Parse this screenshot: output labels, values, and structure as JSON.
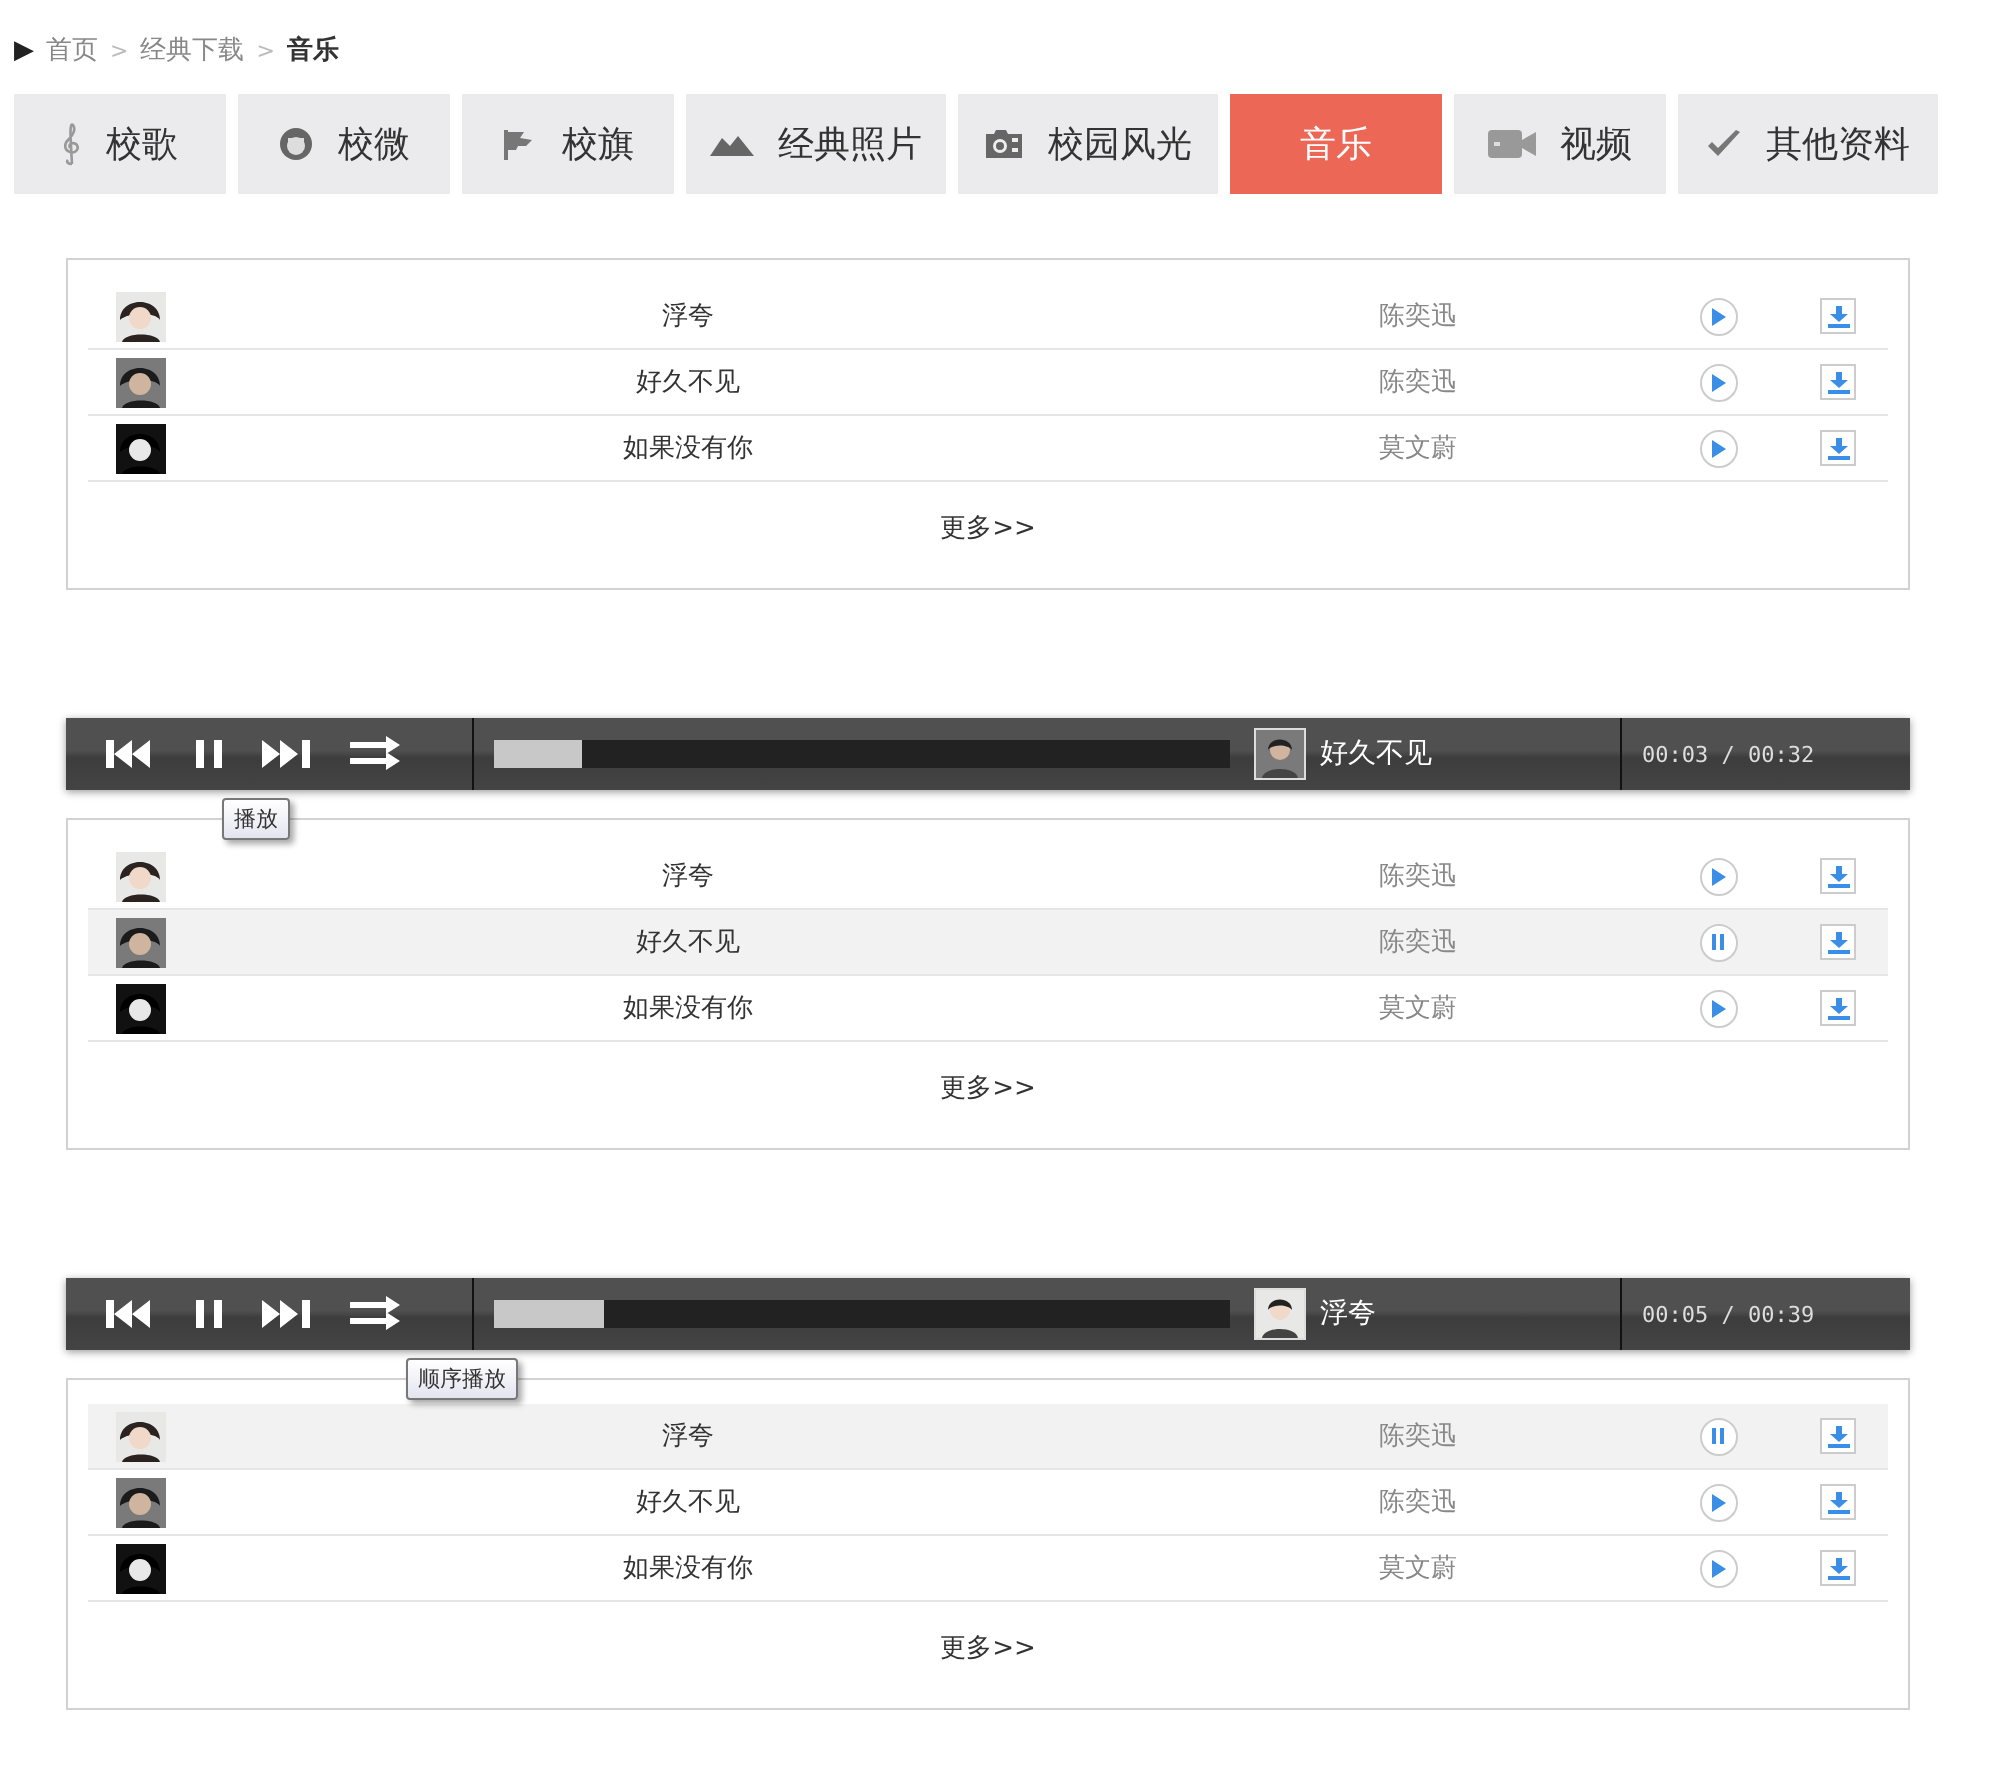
{
  "breadcrumb": {
    "marker": "▶",
    "items": [
      {
        "label": "首页",
        "current": false
      },
      {
        "label": "经典下载",
        "current": false
      },
      {
        "label": "音乐",
        "current": true
      }
    ],
    "separator": ">"
  },
  "tabs": [
    {
      "label": "校歌",
      "selected": false
    },
    {
      "label": "校微",
      "selected": false
    },
    {
      "label": "校旗",
      "selected": false
    },
    {
      "label": "经典照片",
      "selected": false
    },
    {
      "label": "校园风光",
      "selected": false
    },
    {
      "label": "音乐",
      "selected": true
    },
    {
      "label": "视频",
      "selected": false
    },
    {
      "label": "其他资料",
      "selected": false
    }
  ],
  "sections": [
    {
      "more": "更多>>",
      "songs": [
        {
          "title": "浮夸",
          "artist": "陈奕迅",
          "playing": false,
          "selected": false
        },
        {
          "title": "好久不见",
          "artist": "陈奕迅",
          "playing": false,
          "selected": false
        },
        {
          "title": "如果没有你",
          "artist": "莫文蔚",
          "playing": false,
          "selected": false
        }
      ]
    },
    {
      "player": {
        "level": 0.12,
        "track": "好久不见",
        "time": "00:03 / 00:32",
        "tooltip": {
          "text": "播放",
          "kind": "pause"
        }
      },
      "more": "更多>>",
      "songs": [
        {
          "title": "浮夸",
          "artist": "陈奕迅",
          "playing": false,
          "selected": false
        },
        {
          "title": "好久不见",
          "artist": "陈奕迅",
          "playing": true,
          "selected": true
        },
        {
          "title": "如果没有你",
          "artist": "莫文蔚",
          "playing": false,
          "selected": false
        }
      ]
    },
    {
      "player": {
        "level": 0.15,
        "track": "浮夸",
        "time": "00:05 / 00:39",
        "tooltip": {
          "text": "顺序播放",
          "kind": "mode"
        }
      },
      "more": "更多>>",
      "songs": [
        {
          "title": "浮夸",
          "artist": "陈奕迅",
          "playing": true,
          "selected": true
        },
        {
          "title": "好久不见",
          "artist": "陈奕迅",
          "playing": false,
          "selected": false
        },
        {
          "title": "如果没有你",
          "artist": "莫文蔚",
          "playing": false,
          "selected": false
        }
      ]
    }
  ]
}
